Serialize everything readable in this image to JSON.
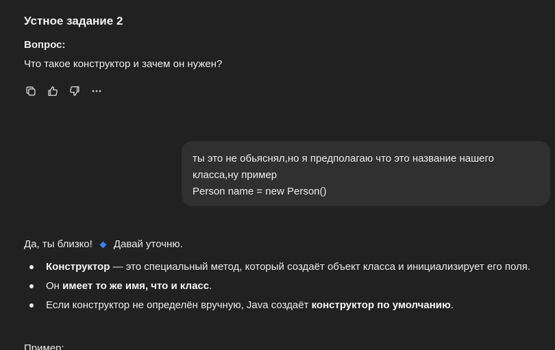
{
  "assistant_prev": {
    "heading": "Устное задание 2",
    "question_label": "Вопрос:",
    "question_text": "Что такое конструктор и зачем он нужен?",
    "action_icons": [
      "copy-icon",
      "thumbs-up-icon",
      "thumbs-down-icon",
      "more-icon"
    ]
  },
  "user_message": {
    "line1": "ты это не обьяснял,но я предполагаю что это название нашего",
    "line2": "класса,ну пример",
    "line3": "Person name = new Person()"
  },
  "reply": {
    "lead_before": "Да, ты близко!",
    "lead_after": "Давай уточню.",
    "bullet1_bold": "Конструктор",
    "bullet1_text": " — это специальный метод, который создаёт объект класса и инициализирует его поля.",
    "bullet2_prefix": "Он ",
    "bullet2_bold": "имеет то же имя, что и класс",
    "bullet2_suffix": ".",
    "bullet3_prefix": "Если конструктор не определён вручную, Java создаёт ",
    "bullet3_bold": "конструктор по умолчанию",
    "bullet3_suffix": ".",
    "example_label": "Пример:"
  },
  "colors": {
    "background": "#212121",
    "bubble": "#303030",
    "accent": "#3b82f6"
  }
}
